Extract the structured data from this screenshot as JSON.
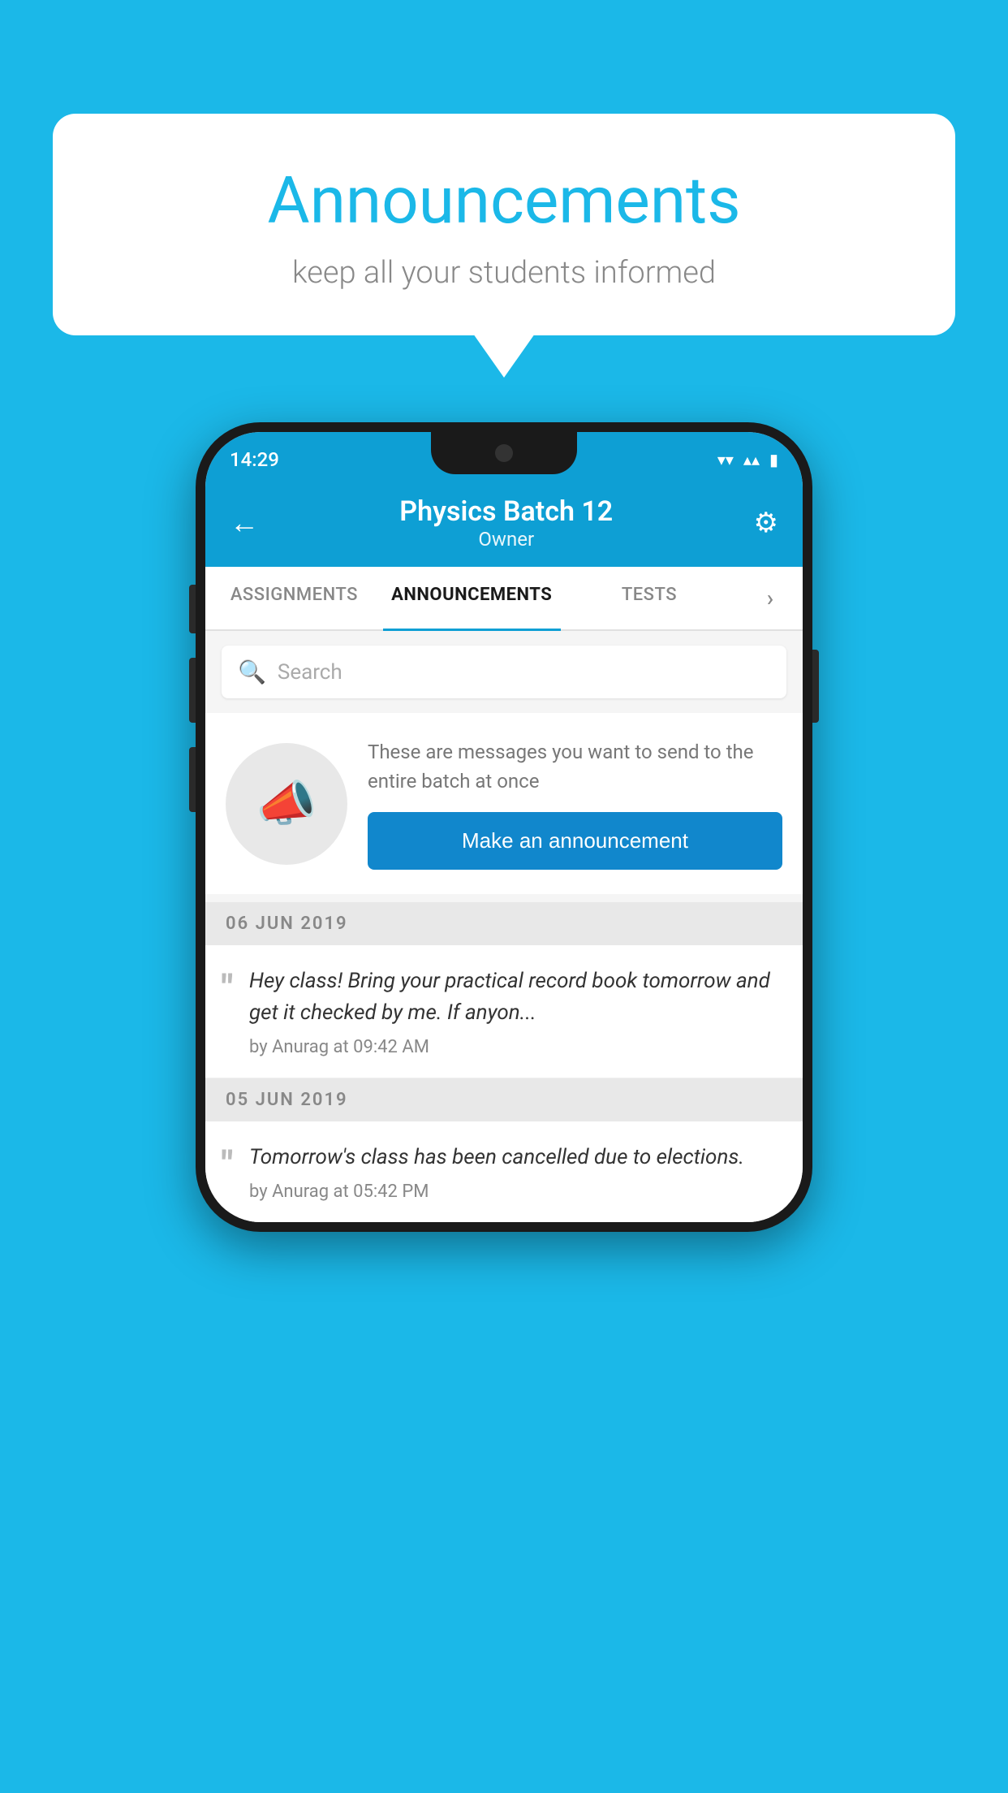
{
  "background_color": "#1bb8e8",
  "speech_bubble": {
    "title": "Announcements",
    "subtitle": "keep all your students informed"
  },
  "status_bar": {
    "time": "14:29",
    "wifi": "▾",
    "signal": "▴",
    "battery": "▮"
  },
  "app_bar": {
    "title": "Physics Batch 12",
    "subtitle": "Owner",
    "back_icon": "←",
    "gear_icon": "⚙"
  },
  "tabs": [
    {
      "label": "ASSIGNMENTS",
      "active": false
    },
    {
      "label": "ANNOUNCEMENTS",
      "active": true
    },
    {
      "label": "TESTS",
      "active": false
    },
    {
      "label": "...",
      "active": false
    }
  ],
  "search": {
    "placeholder": "Search"
  },
  "announcement_prompt": {
    "description": "These are messages you want to send to the entire batch at once",
    "button_label": "Make an announcement"
  },
  "announcements": [
    {
      "date": "06  JUN  2019",
      "text": "Hey class! Bring your practical record book tomorrow and get it checked by me. If anyon...",
      "meta": "by Anurag at 09:42 AM"
    },
    {
      "date": "05  JUN  2019",
      "text": "Tomorrow's class has been cancelled due to elections.",
      "meta": "by Anurag at 05:42 PM"
    }
  ]
}
